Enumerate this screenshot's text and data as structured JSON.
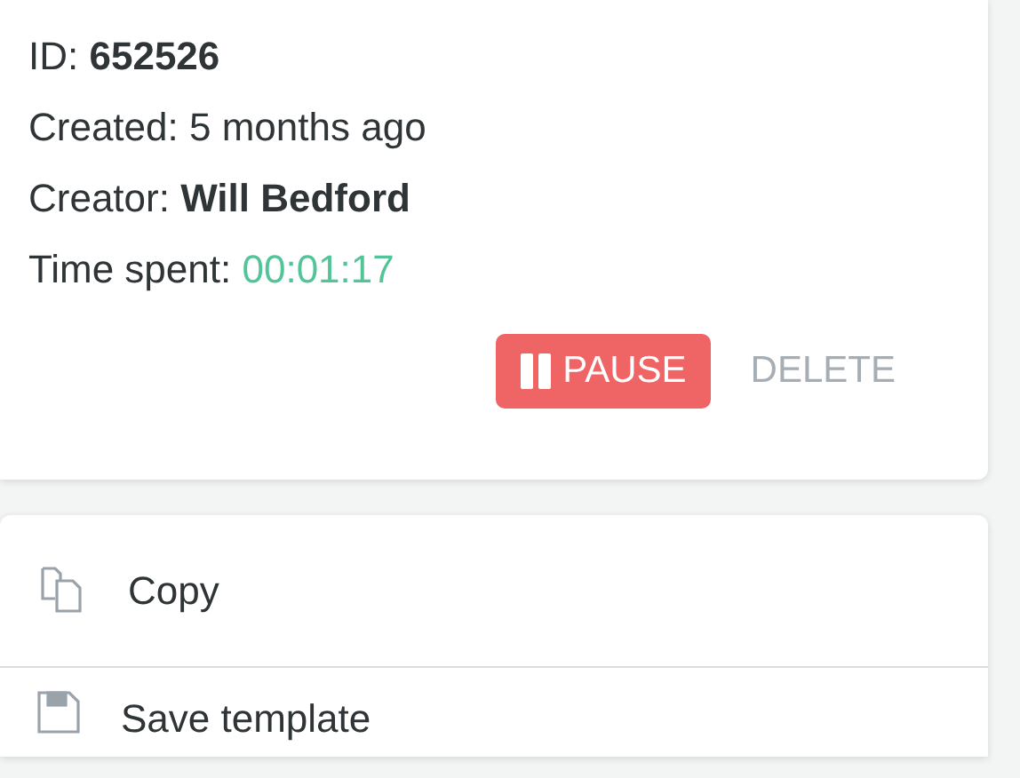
{
  "details": [
    {
      "label": "ID:",
      "value": "652526",
      "kind": "bold"
    },
    {
      "label": "Created:",
      "value": "5 months ago",
      "kind": "plain"
    },
    {
      "label": "Creator:",
      "value": "Will Bedford",
      "kind": "bold"
    },
    {
      "label": "Time spent:",
      "value": "00:01:17",
      "kind": "accent"
    }
  ],
  "actions": [
    {
      "label": "PAUSE",
      "kind": "primary"
    },
    {
      "label": "DELETE",
      "kind": "text"
    }
  ],
  "menu": [
    {
      "label": "Copy",
      "kind": "copy"
    },
    {
      "label": "Save template",
      "kind": "save"
    }
  ]
}
